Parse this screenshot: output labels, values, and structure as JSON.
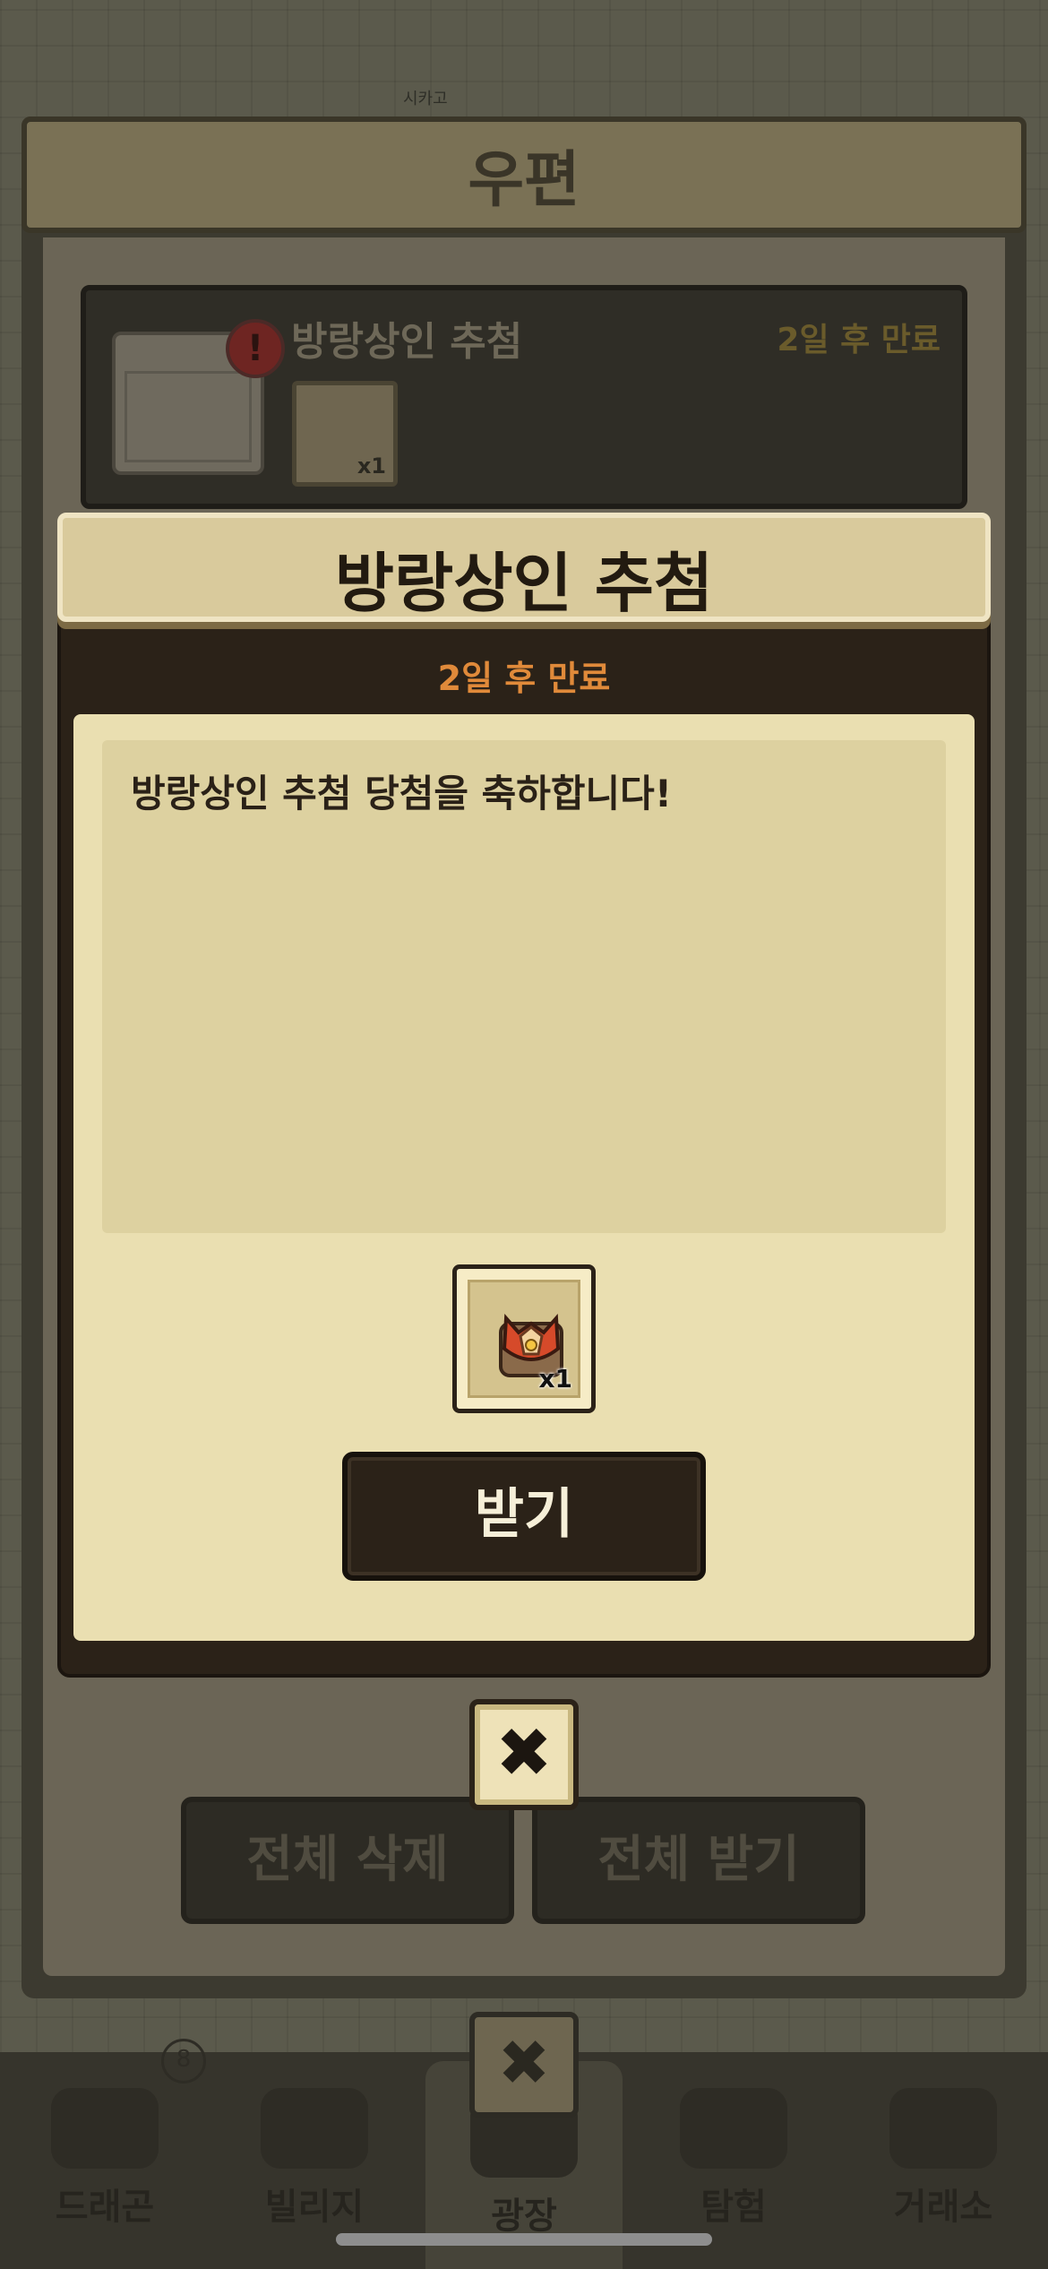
{
  "background": {
    "map_label": "시카고"
  },
  "bottom_nav": {
    "badge": "8",
    "items": [
      {
        "label": "드래곤"
      },
      {
        "label": "빌리지"
      },
      {
        "label": "광장"
      },
      {
        "label": "탐험"
      },
      {
        "label": "거래소"
      }
    ]
  },
  "mailbox": {
    "title": "우편",
    "mail": {
      "title": "방랑상인 추첨",
      "expiry": "2일 후 만료",
      "item_qty": "x1",
      "alert": "!"
    },
    "delete_all_label": "전체 삭제",
    "claim_all_label": "전체 받기",
    "close_icon": "✖"
  },
  "popup": {
    "title": "방랑상인 추첨",
    "expiry": "2일 후 만료",
    "message": "방랑상인 추첨 당첨을 축하합니다!",
    "reward_qty": "x1",
    "claim_label": "받기",
    "close_icon": "✖"
  },
  "colors": {
    "popup_paper": "#eadfb1",
    "expiry_accent": "#e08a3a",
    "dark_frame": "#2b2218"
  }
}
